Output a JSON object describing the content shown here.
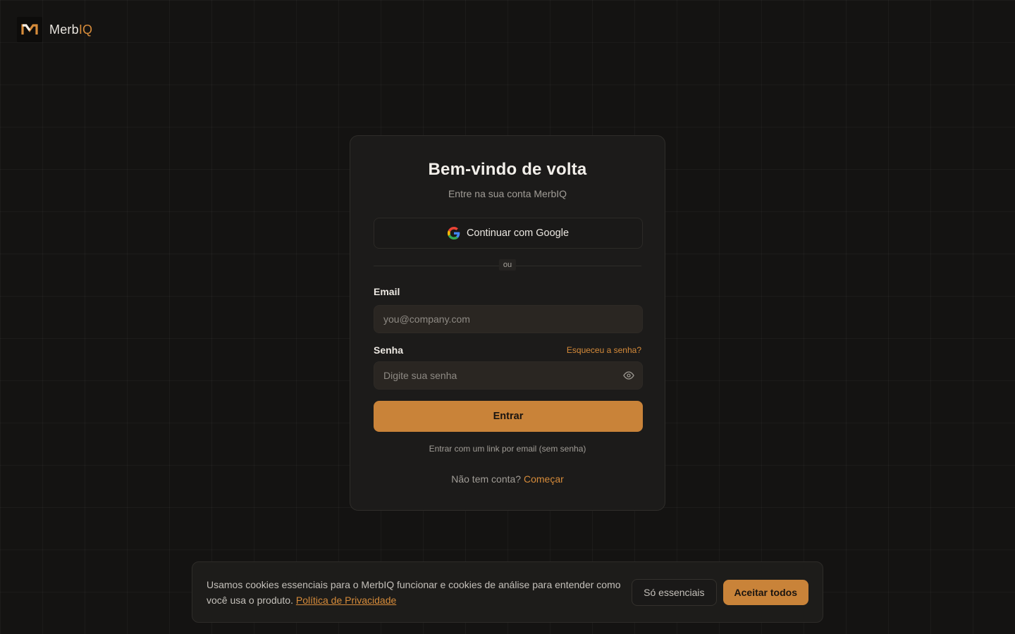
{
  "brand": {
    "name_prefix": "Merb",
    "name_accent": "IQ",
    "logo_icon": "merbiq-logo-icon"
  },
  "login": {
    "title": "Bem-vindo de volta",
    "subtitle": "Entre na sua conta MerbIQ",
    "google_button": "Continuar com Google",
    "google_icon": "google-icon",
    "divider": "ou",
    "email_label": "Email",
    "email_placeholder": "you@company.com",
    "email_value": "",
    "password_label": "Senha",
    "forgot_link": "Esqueceu a senha?",
    "password_placeholder": "Digite sua senha",
    "password_value": "",
    "show_password_icon": "eye-icon",
    "submit_label": "Entrar",
    "magic_link": "Entrar com um link por email (sem senha)",
    "signup_prompt": "Não tem conta?",
    "signup_link": "Começar"
  },
  "cookie_banner": {
    "text": "Usamos cookies essenciais para o MerbIQ funcionar e cookies de análise para entender como você usa o produto.",
    "policy_link": "Política de Privacidade",
    "essentials_button": "Só essenciais",
    "accept_all_button": "Aceitar todos"
  },
  "colors": {
    "accent": "#d68b3a",
    "primary_button": "#c98339",
    "background": "#141312",
    "card": "#1c1b1a"
  }
}
